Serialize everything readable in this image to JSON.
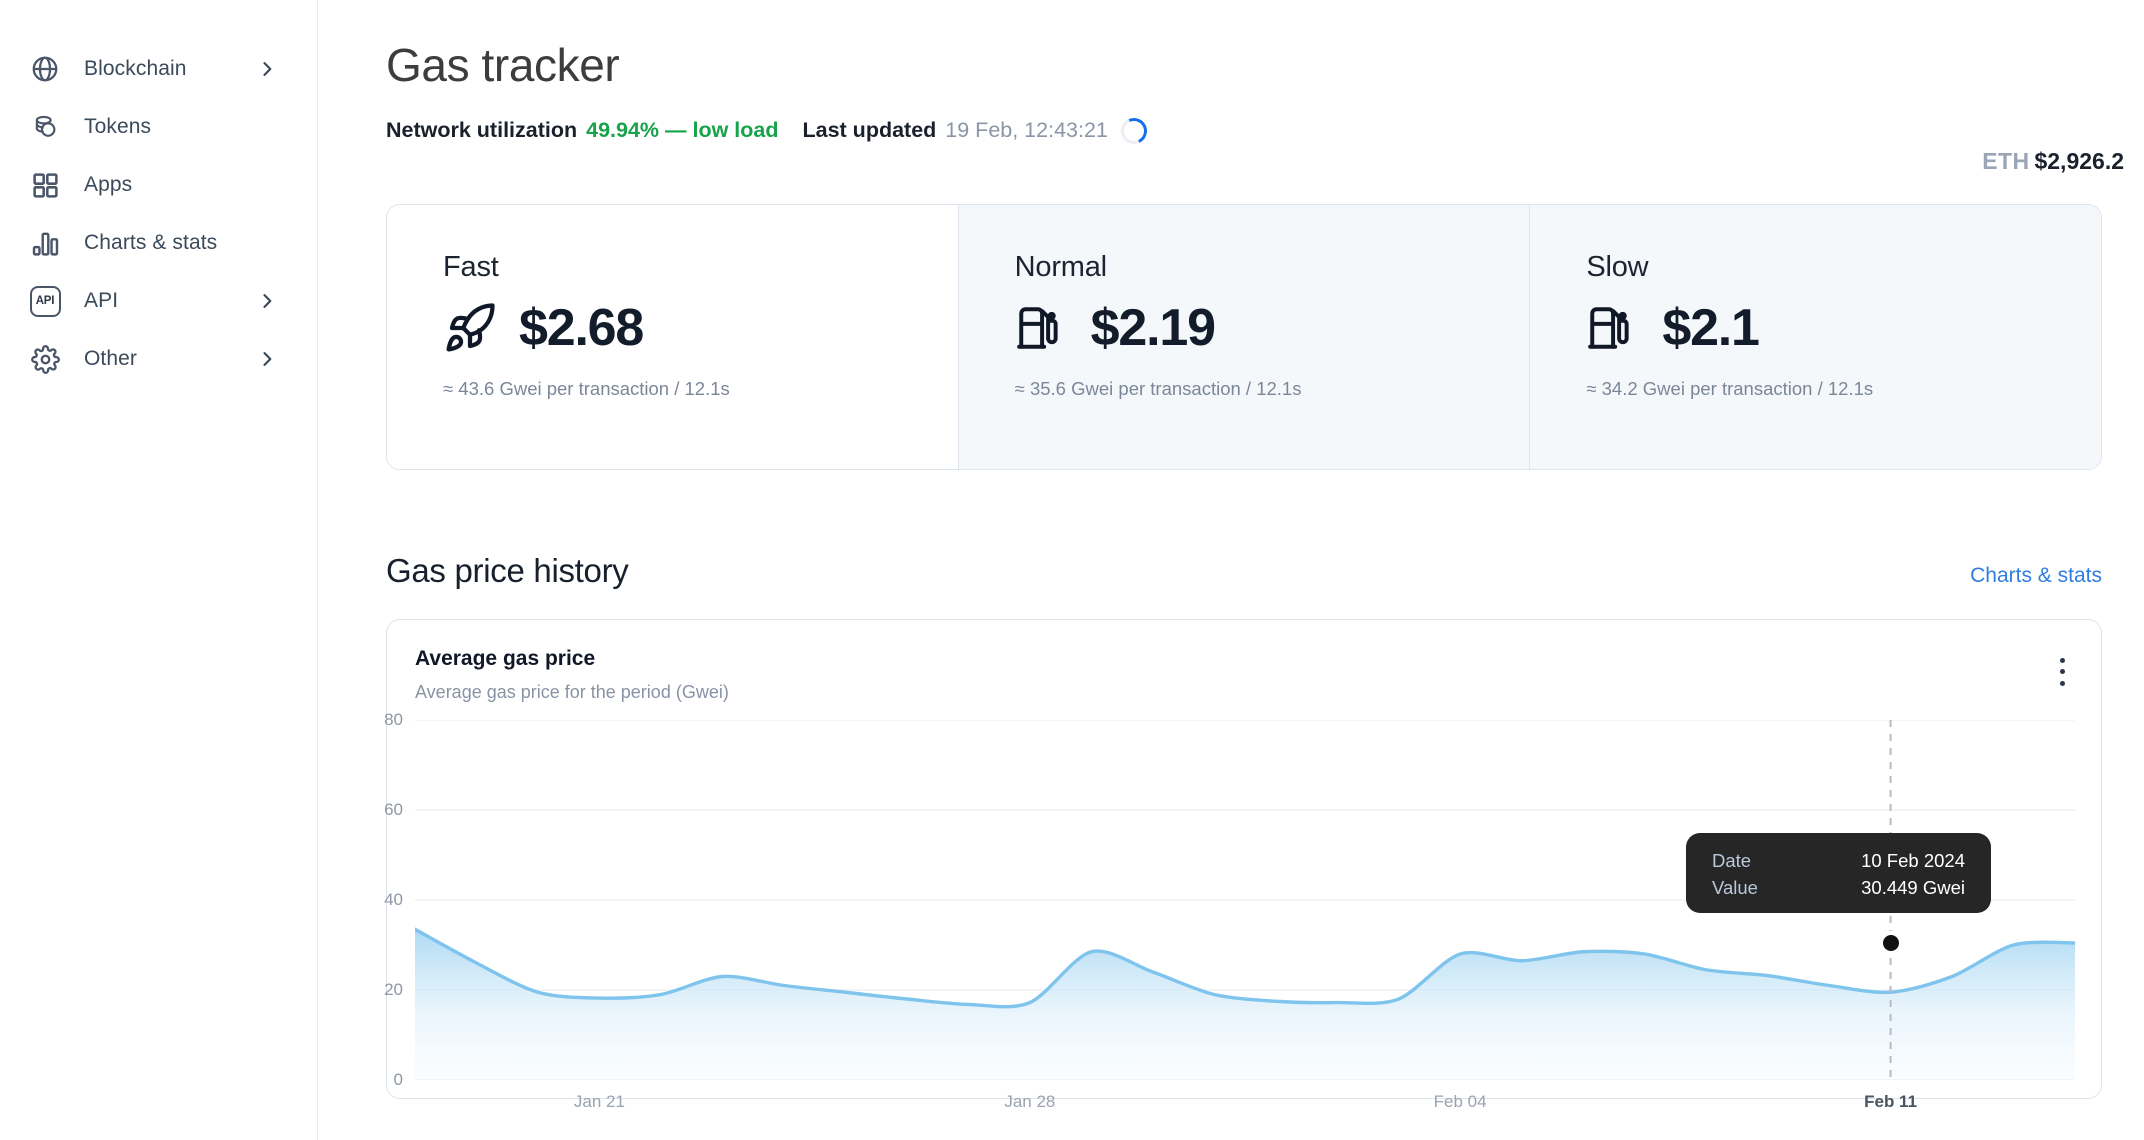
{
  "sidebar": {
    "items": [
      {
        "label": "Blockchain",
        "icon": "globe-icon",
        "chevron": true
      },
      {
        "label": "Tokens",
        "icon": "coins-icon",
        "chevron": false
      },
      {
        "label": "Apps",
        "icon": "grid-icon",
        "chevron": false
      },
      {
        "label": "Charts & stats",
        "icon": "bar-chart-icon",
        "chevron": false
      },
      {
        "label": "API",
        "icon": "api-icon",
        "chevron": true
      },
      {
        "label": "Other",
        "icon": "gear-icon",
        "chevron": true
      }
    ]
  },
  "header": {
    "title": "Gas tracker",
    "utilization_label": "Network utilization",
    "utilization_value": "49.94% — low load",
    "utilization_color": "#16a34a",
    "last_updated_label": "Last updated",
    "last_updated_value": "19 Feb, 12:43:21",
    "spinner_icon": "loading-spinner-icon",
    "eth_symbol": "ETH",
    "eth_price": "$2,926.2"
  },
  "gas_cards": [
    {
      "title": "Fast",
      "icon": "rocket-icon",
      "price": "$2.68",
      "detail": "≈ 43.6 Gwei per transaction / 12.1s",
      "highlighted": true
    },
    {
      "title": "Normal",
      "icon": "gas-pump-icon",
      "price": "$2.19",
      "detail": "≈ 35.6 Gwei per transaction / 12.1s",
      "highlighted": false
    },
    {
      "title": "Slow",
      "icon": "gas-pump-icon",
      "price": "$2.1",
      "detail": "≈ 34.2 Gwei per transaction / 12.1s",
      "highlighted": false
    }
  ],
  "history": {
    "section_title": "Gas price history",
    "link_label": "Charts & stats",
    "card_title": "Average gas price",
    "card_subtitle": "Average gas price for the period (Gwei)",
    "menu_icon": "kebab-menu-icon"
  },
  "tooltip": {
    "date_key": "Date",
    "date_value": "10 Feb 2024",
    "value_key": "Value",
    "value_value": "30.449 Gwei"
  },
  "chart_data": {
    "type": "area",
    "title": "Average gas price",
    "subtitle": "Average gas price for the period (Gwei)",
    "xlabel": "",
    "ylabel": "Gwei",
    "ylim": [
      0,
      80
    ],
    "yticks": [
      0,
      20,
      40,
      60,
      80
    ],
    "grid": true,
    "legend": false,
    "line_color": "#7ec4ec",
    "fill_color": "#cfe6f7",
    "xticks": [
      {
        "label": "Jan 21",
        "x": 0.1111,
        "active": false
      },
      {
        "label": "Jan 28",
        "x": 0.3704,
        "active": false
      },
      {
        "label": "Feb 04",
        "x": 0.6296,
        "active": false
      },
      {
        "label": "Feb 11",
        "x": 0.8889,
        "active": true
      }
    ],
    "highlight": {
      "x_label": "Feb 11",
      "x": 0.8889,
      "value": 30.449,
      "date": "10 Feb 2024"
    },
    "x": [
      "Jan 18",
      "Jan 19",
      "Jan 20",
      "Jan 21",
      "Jan 22",
      "Jan 23",
      "Jan 24",
      "Jan 25",
      "Jan 26",
      "Jan 27",
      "Jan 28",
      "Jan 29",
      "Jan 30",
      "Jan 31",
      "Feb 01",
      "Feb 02",
      "Feb 03",
      "Feb 04",
      "Feb 05",
      "Feb 06",
      "Feb 07",
      "Feb 08",
      "Feb 09",
      "Feb 10",
      "Feb 11",
      "Feb 12",
      "Feb 13",
      "Feb 14"
    ],
    "values": [
      33.5,
      26.0,
      19.5,
      18.2,
      19.0,
      23.0,
      21.0,
      19.5,
      18.0,
      16.8,
      17.2,
      28.5,
      24.0,
      19.0,
      17.5,
      17.2,
      18.0,
      28.0,
      26.5,
      28.5,
      28.0,
      24.5,
      23.2,
      21.0,
      19.5,
      23.0,
      30.0,
      30.449
    ]
  }
}
